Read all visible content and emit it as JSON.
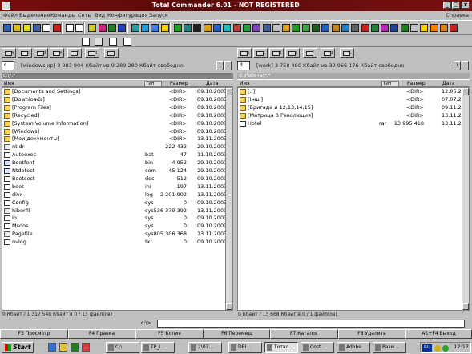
{
  "window": {
    "title": "Total Commander 6.01 - NOT REGISTERED",
    "min_label": "_",
    "max_label": "□",
    "close_label": "x"
  },
  "menu": {
    "items": [
      "Файл",
      "Выделение",
      "Команды",
      "Сеть",
      "Вид",
      "Конфигурация",
      "Запуск"
    ],
    "help": "Справка"
  },
  "toolbar": {
    "icons": [
      {
        "name": "refresh-icon",
        "color": "#3060c0"
      },
      {
        "name": "brief-view-icon",
        "color": "#e0c020"
      },
      {
        "name": "detailed-view-icon",
        "color": "#e0e020"
      },
      {
        "name": "thumbnails-icon",
        "color": "#4060a0"
      },
      {
        "name": "tree-icon",
        "color": "#ffffff"
      },
      {
        "name": "filter-icon",
        "color": "#d02020"
      },
      {
        "name": "back-icon",
        "color": "#ffffff"
      },
      {
        "name": "forward-icon",
        "color": "#ffffff"
      },
      {
        "name": "pack-icon",
        "color": "#d0d020"
      },
      {
        "name": "unpack-icon",
        "color": "#d02080"
      },
      {
        "name": "ftp-connect-icon",
        "color": "#208020"
      },
      {
        "name": "ftp-new-icon",
        "color": "#2040c0"
      },
      {
        "name": "find-icon",
        "color": "#20a0a0"
      },
      {
        "name": "view-icon",
        "color": "#20a0e0"
      },
      {
        "name": "edit-icon",
        "color": "#4080e0"
      },
      {
        "name": "copy-icon",
        "color": "#ffd000"
      },
      {
        "name": "globe-icon",
        "color": "#20a020"
      },
      {
        "name": "network-icon",
        "color": "#208080"
      },
      {
        "name": "batman-icon",
        "color": "#202020"
      },
      {
        "name": "mail-icon",
        "color": "#e0a000"
      },
      {
        "name": "ie-icon",
        "color": "#2060d0"
      },
      {
        "name": "sync-icon",
        "color": "#20c0c0"
      },
      {
        "name": "compare-icon",
        "color": "#c04040"
      },
      {
        "name": "notes-icon",
        "color": "#20a040"
      },
      {
        "name": "image-icon",
        "color": "#8040c0"
      },
      {
        "name": "monitor-icon",
        "color": "#4060a0"
      },
      {
        "name": "disk-icon",
        "color": "#c0c0c0"
      },
      {
        "name": "folder-icon",
        "color": "#e0a020"
      },
      {
        "name": "tools-icon",
        "color": "#20a020"
      },
      {
        "name": "chip-icon",
        "color": "#40a040"
      },
      {
        "name": "music-icon",
        "color": "#206020"
      },
      {
        "name": "chart-icon",
        "color": "#2060c0"
      },
      {
        "name": "search-pc-icon",
        "color": "#c08020"
      },
      {
        "name": "network-neighborhood-icon",
        "color": "#2080c0"
      },
      {
        "name": "printer-icon",
        "color": "#606060"
      },
      {
        "name": "gamepad-icon",
        "color": "#d02020"
      },
      {
        "name": "terminal-icon",
        "color": "#208040"
      },
      {
        "name": "stamp-icon",
        "color": "#c020c0"
      },
      {
        "name": "warning-icon",
        "color": "#2040a0"
      },
      {
        "name": "user-icon",
        "color": "#208020"
      },
      {
        "name": "cd-icon",
        "color": "#c0c0c0"
      },
      {
        "name": "key-icon",
        "color": "#ffd000"
      },
      {
        "name": "rocket-icon",
        "color": "#ff8000"
      },
      {
        "name": "pencil-icon",
        "color": "#e08020"
      },
      {
        "name": "stop-icon",
        "color": "#d02020"
      }
    ]
  },
  "left": {
    "drive_combo": "c",
    "drive_info": "[windows xp]  3 003 904 Кбайт из 9 289 280 Кбайт свободно",
    "root_btn": "\\",
    "up_btn": "..",
    "path": "c:\\*.*",
    "columns": {
      "name": "Имя",
      "ext": "Тип",
      "size": "Размер",
      "date": "Дата"
    },
    "rows": [
      {
        "icon": "folder",
        "name": "[Documents and Settings]",
        "ext": "",
        "size": "<DIR>",
        "date": "09.10.2003"
      },
      {
        "icon": "folder",
        "name": "[Downloads]",
        "ext": "",
        "size": "<DIR>",
        "date": "09.10.2003"
      },
      {
        "icon": "folder",
        "name": "[Program Files]",
        "ext": "",
        "size": "<DIR>",
        "date": "09.10.2003"
      },
      {
        "icon": "folder",
        "name": "[Recycled]",
        "ext": "",
        "size": "<DIR>",
        "date": "09.10.2003"
      },
      {
        "icon": "folder",
        "name": "[System Volume Information]",
        "ext": "",
        "size": "<DIR>",
        "date": "09.10.2003"
      },
      {
        "icon": "folder",
        "name": "[Windows]",
        "ext": "",
        "size": "<DIR>",
        "date": "09.10.2003"
      },
      {
        "icon": "folder",
        "name": "[Мои документы]",
        "ext": "",
        "size": "<DIR>",
        "date": "13.11.2003"
      },
      {
        "icon": "sys",
        "name": "ntldr",
        "ext": "",
        "size": "222 432",
        "date": "29.10.2001"
      },
      {
        "icon": "file",
        "name": "Autoexec",
        "ext": "bat",
        "size": "47",
        "date": "11.10.2003"
      },
      {
        "icon": "exe",
        "name": "Bootfont",
        "ext": "bin",
        "size": "4 952",
        "date": "29.10.2001"
      },
      {
        "icon": "exe",
        "name": "Ntdetect",
        "ext": "com",
        "size": "45 124",
        "date": "29.10.2001"
      },
      {
        "icon": "file",
        "name": "Bootsect",
        "ext": "dos",
        "size": "512",
        "date": "09.10.2003"
      },
      {
        "icon": "file",
        "name": "boot",
        "ext": "ini",
        "size": "197",
        "date": "13.11.2003"
      },
      {
        "icon": "file",
        "name": "divx",
        "ext": "log",
        "size": "2 201 902",
        "date": "13.11.2003"
      },
      {
        "icon": "file",
        "name": "Config",
        "ext": "sys",
        "size": "0",
        "date": "09.10.2003"
      },
      {
        "icon": "sys",
        "name": "hiberfil",
        "ext": "sys",
        "size": "536 379 392",
        "date": "13.11.2003"
      },
      {
        "icon": "file",
        "name": "Io",
        "ext": "sys",
        "size": "0",
        "date": "09.10.2003"
      },
      {
        "icon": "file",
        "name": "Msdos",
        "ext": "sys",
        "size": "0",
        "date": "09.10.2003"
      },
      {
        "icon": "sys",
        "name": "Pagefile",
        "ext": "sys",
        "size": "805 306 368",
        "date": "13.11.2003"
      },
      {
        "icon": "file",
        "name": "nvlog",
        "ext": "txt",
        "size": "0",
        "date": "09.10.2003"
      }
    ],
    "status": "0 Кбайт / 1 317 548 Кбайт в 0 / 13 файл(ов)"
  },
  "right": {
    "drive_combo": "d",
    "drive_info": "[work]  3 758 480 Кбайт из 39 966 176 Кбайт свободно",
    "root_btn": "\\",
    "up_btn": "..",
    "path": "d:\\Работа\\*.*",
    "columns": {
      "name": "Имя",
      "ext": "Тип",
      "size": "Размер",
      "date": "Дата"
    },
    "rows": [
      {
        "icon": "folder",
        "name": "[..]",
        "ext": "",
        "size": "<DIR>",
        "date": "12.05.2003"
      },
      {
        "icon": "folder",
        "name": "[Інші]",
        "ext": "",
        "size": "<DIR>",
        "date": "07.07.2003"
      },
      {
        "icon": "folder",
        "name": "[Бригада и 12,13,14,15]",
        "ext": "",
        "size": "<DIR>",
        "date": "09.11.2003"
      },
      {
        "icon": "folder",
        "name": "[Матрица 3 Революция]",
        "ext": "",
        "size": "<DIR>",
        "date": "13.11.2003"
      },
      {
        "icon": "file",
        "name": "Hotel",
        "ext": "rar",
        "size": "13 995 418",
        "date": "13.11.2003"
      }
    ],
    "status": "0 Кбайт / 13 668 Кбайт в 0 / 1 файл(ов)"
  },
  "cmdline": {
    "label": "c:\\>",
    "value": ""
  },
  "fkeys": [
    "F3 Просмотр",
    "F4 Правка",
    "F5 Копия",
    "F6 Перемещ",
    "F7 Каталог",
    "F8 Удалить",
    "Alt+F4 Выход"
  ],
  "taskbar": {
    "start_label": "Start",
    "tasks": [
      "C:\\",
      "TP_I...",
      "2\\07...",
      "DEI...",
      "Тотал...",
      "Cost...",
      "Adobe...",
      "Разм..."
    ],
    "lang": "RU",
    "clock": "12:17"
  }
}
